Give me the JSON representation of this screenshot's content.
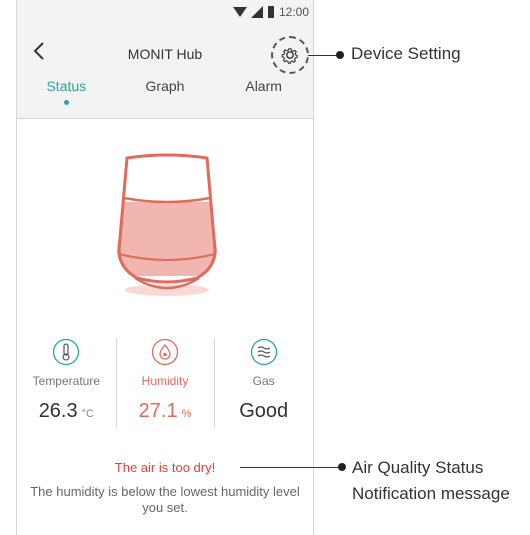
{
  "status_bar": {
    "time": "12:00"
  },
  "header": {
    "title": "MONIT Hub"
  },
  "tabs": [
    {
      "label": "Status",
      "active": true
    },
    {
      "label": "Graph",
      "active": false
    },
    {
      "label": "Alarm",
      "active": false
    }
  ],
  "metrics": [
    {
      "label": "Temperature",
      "value": "26.3",
      "unit": "°C",
      "icon": "thermometer-icon",
      "highlighted": false
    },
    {
      "label": "Humidity",
      "value": "27.1",
      "unit": "%",
      "icon": "water-drop-icon",
      "highlighted": true
    },
    {
      "label": "Gas",
      "value": "Good",
      "unit": "",
      "icon": "gas-waves-icon",
      "highlighted": false
    }
  ],
  "notification": {
    "title": "The air is too dry!",
    "message": "The humidity is below the lowest humidity level you set."
  },
  "annotations": {
    "device_setting": "Device Setting",
    "air_quality_line1": "Air Quality Status",
    "air_quality_line2": "Notification message"
  },
  "colors": {
    "accent": "#29a89a",
    "alert": "#e2403a",
    "device_fill": "#f2b6b0",
    "device_stroke": "#e06a5c"
  }
}
